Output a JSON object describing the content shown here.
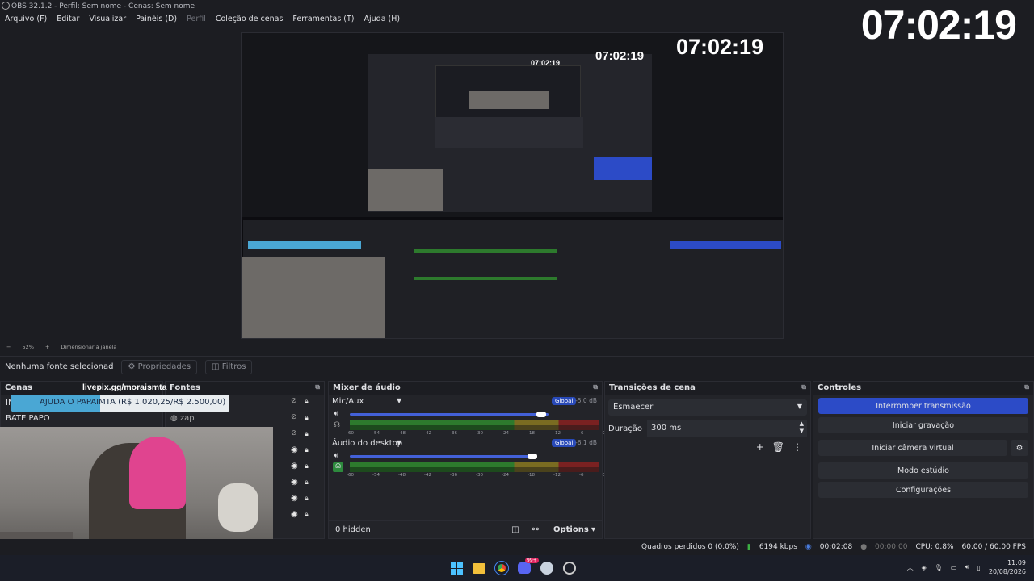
{
  "window": {
    "title": "OBS 32.1.2 - Perfil: Sem nome - Cenas: Sem nome"
  },
  "menu": [
    "Arquivo (F)",
    "Editar",
    "Visualizar",
    "Painéis (D)",
    "Perfil",
    "Coleção de cenas",
    "Ferramentas (T)",
    "Ajuda (H)"
  ],
  "clock": {
    "main": "07:02:19",
    "nested1": "07:02:19",
    "nested2": "07:02:19",
    "nested3": "07:02:19"
  },
  "preview_status": {
    "zoom": "52%",
    "fit": "Dimensionar à janela"
  },
  "source_bar": {
    "none_selected": "Nenhuma fonte selecionad",
    "properties": "Propriedades",
    "filters": "Filtros"
  },
  "scenes": {
    "title": "Cenas",
    "items": [
      "IN",
      "BATE PAPO"
    ]
  },
  "sources": {
    "title": "Fontes",
    "overlay_url": "livepix.gg/moraismta",
    "item": "zap"
  },
  "donation": {
    "text": "AJUDA O PAPAIMTA (R$ 1.020,25/R$ 2.500,00)",
    "progress": 0.408
  },
  "mixer": {
    "title": "Mixer de áudio",
    "channels": [
      {
        "name": "Mic/Aux",
        "db": "-5.0 dB",
        "badge": "Global",
        "level": 0.8
      },
      {
        "name": "Áudio do desktop",
        "db": "-6.1 dB",
        "badge": "Global",
        "level": 0.76
      }
    ],
    "ticks": [
      "-60",
      "-54",
      "-48",
      "-42",
      "-36",
      "-30",
      "-24",
      "-18",
      "-12",
      "-6",
      "0"
    ],
    "hidden": "0 hidden",
    "options": "Options"
  },
  "transitions": {
    "title": "Transições de cena",
    "selected": "Esmaecer",
    "duration_label": "Duração",
    "duration": "300 ms"
  },
  "controls": {
    "title": "Controles",
    "buttons": [
      "Interromper transmissão",
      "Iniciar gravação",
      "Iniciar câmera virtual",
      "Modo estúdio",
      "Configurações"
    ]
  },
  "status": {
    "dropped": "Quadros perdidos 0 (0.0%)",
    "bitrate": "6194 kbps",
    "stream_time": "00:02:08",
    "rec_time": "00:00:00",
    "cpu": "CPU: 0.8%",
    "fps": "60.00 / 60.00 FPS"
  },
  "taskbar": {
    "time": "11:09",
    "date": "20/08/2026",
    "badge": "99+"
  },
  "colors": {
    "accent": "#2c4bc7",
    "bg": "#1c1d22",
    "panel": "#232429"
  }
}
